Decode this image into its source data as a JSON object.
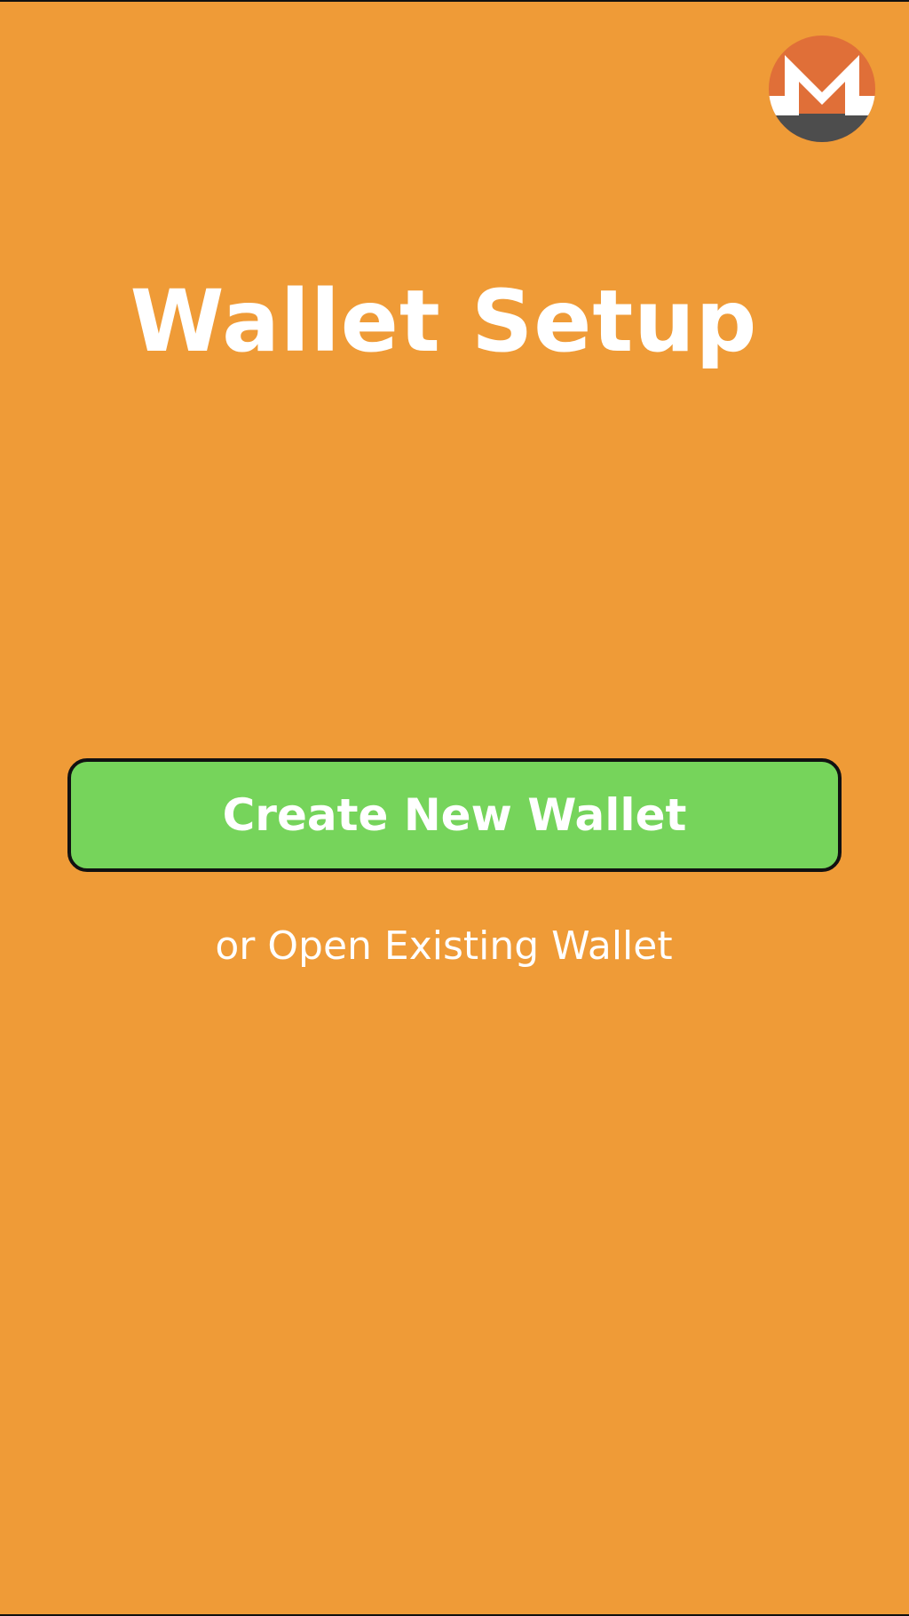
{
  "screen": {
    "title": "Wallet Setup",
    "background_color": "#ef9b37"
  },
  "logo": {
    "icon": "monero-logo-icon",
    "colors": {
      "top": "#e06f38",
      "bottom": "#4d4d4d",
      "mark": "#ffffff"
    }
  },
  "actions": {
    "create_label": "Create New Wallet",
    "create_color": "#76d45b",
    "open_label": "or Open Existing Wallet"
  }
}
